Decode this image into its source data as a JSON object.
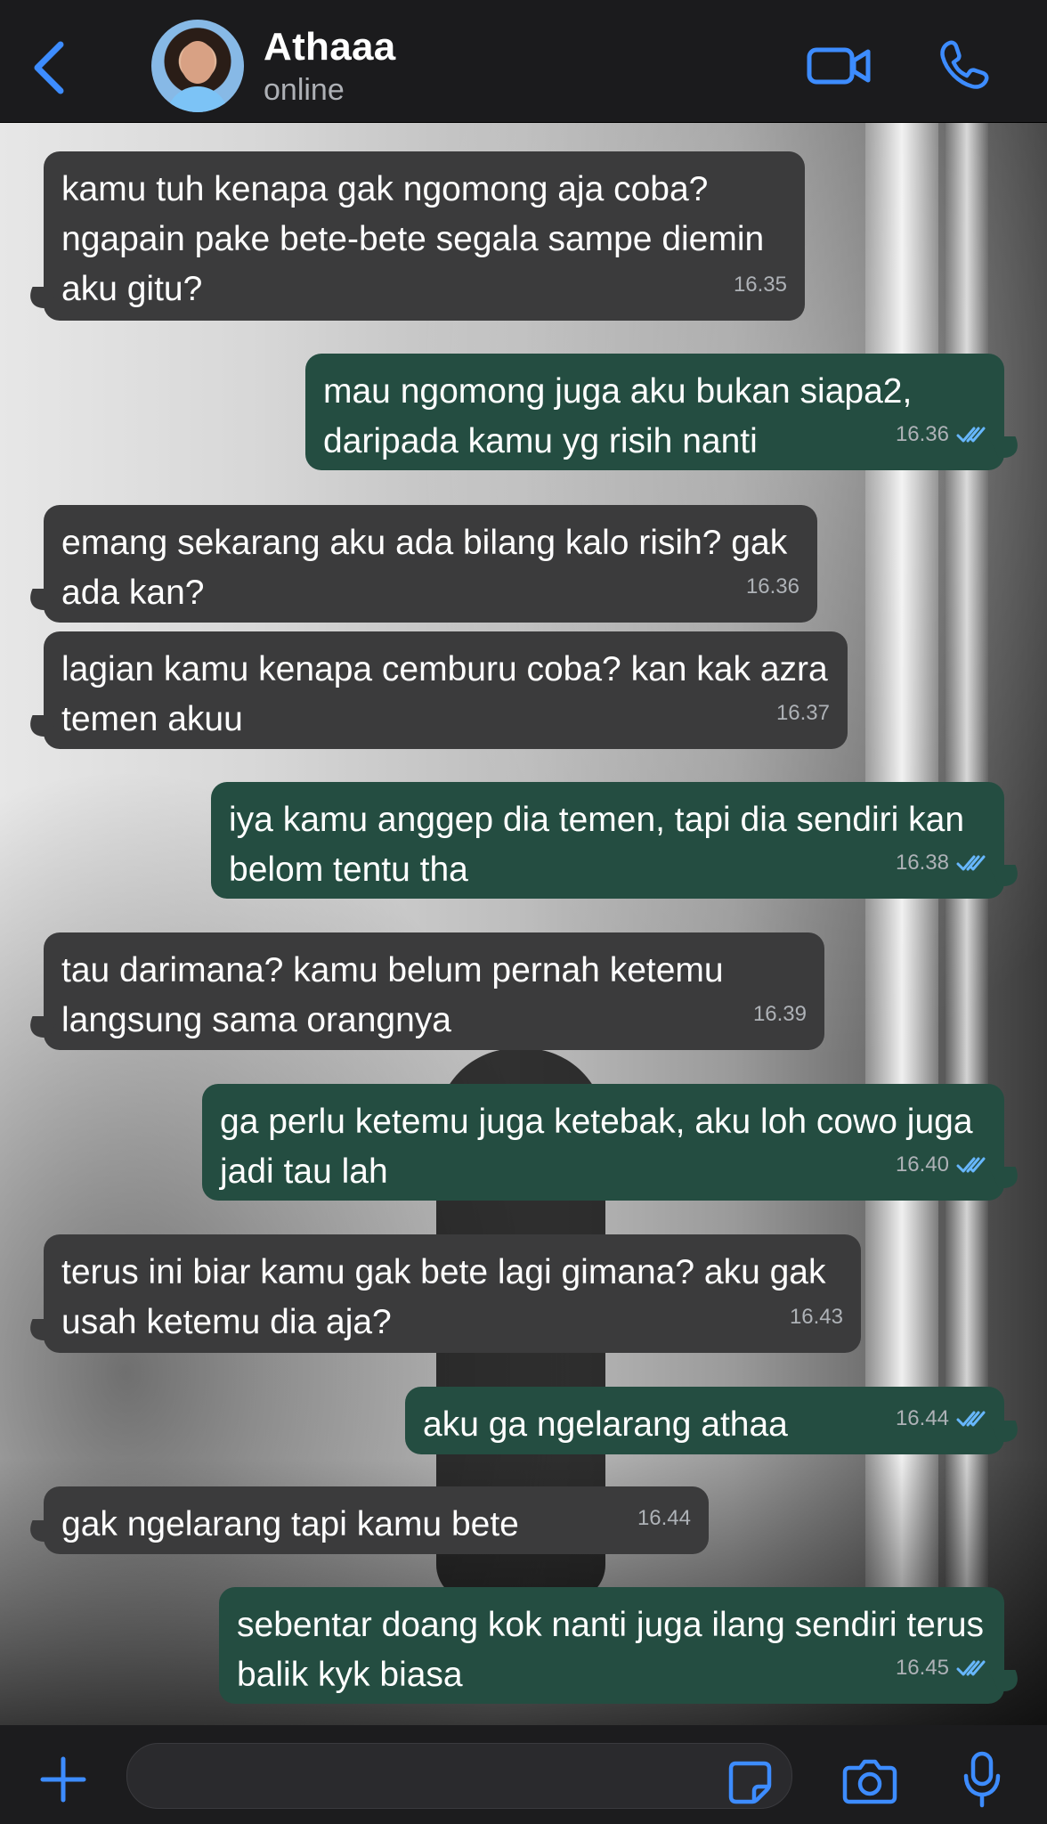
{
  "header": {
    "contact_name": "Athaaa",
    "status": "online",
    "back_icon": "chevron-left-icon",
    "video_icon": "video-call-icon",
    "call_icon": "phone-icon"
  },
  "messages": [
    {
      "direction": "incoming",
      "text": "kamu tuh kenapa gak ngomong aja coba? ngapain pake bete-bete segala sampe diemin aku gitu?",
      "time": "16.35"
    },
    {
      "direction": "outgoing",
      "text": "mau ngomong juga aku bukan siapa2, daripada kamu yg risih nanti",
      "time": "16.36",
      "read": true
    },
    {
      "direction": "incoming",
      "text": "emang sekarang aku ada bilang kalo risih? gak ada kan?",
      "time": "16.36"
    },
    {
      "direction": "incoming",
      "text": "lagian kamu kenapa cemburu coba? kan kak azra temen akuu",
      "time": "16.37"
    },
    {
      "direction": "outgoing",
      "text": "iya kamu anggep dia temen, tapi dia sendiri kan belom tentu tha",
      "time": "16.38",
      "read": true
    },
    {
      "direction": "incoming",
      "text": "tau darimana? kamu belum pernah ketemu langsung sama orangnya",
      "time": "16.39"
    },
    {
      "direction": "outgoing",
      "text": "ga perlu ketemu juga ketebak, aku loh cowo juga jadi tau lah",
      "time": "16.40",
      "read": true
    },
    {
      "direction": "incoming",
      "text": "terus ini biar kamu gak bete lagi gimana? aku gak usah ketemu dia aja?",
      "time": "16.43"
    },
    {
      "direction": "outgoing",
      "text": "aku ga ngelarang athaa",
      "time": "16.44",
      "read": true
    },
    {
      "direction": "incoming",
      "text": "gak ngelarang tapi kamu bete",
      "time": "16.44"
    },
    {
      "direction": "outgoing",
      "text": "sebentar doang kok nanti juga ilang sendiri terus balik kyk biasa",
      "time": "16.45",
      "read": true
    }
  ],
  "input_bar": {
    "plus_icon": "plus-icon",
    "sticker_icon": "sticker-icon",
    "camera_icon": "camera-icon",
    "mic_icon": "microphone-icon",
    "message_value": ""
  },
  "colors": {
    "accent": "#3d8cff",
    "incoming_bubble": "#3b3b3c",
    "outgoing_bubble": "#244d41",
    "read_receipt": "#67b7ff"
  }
}
